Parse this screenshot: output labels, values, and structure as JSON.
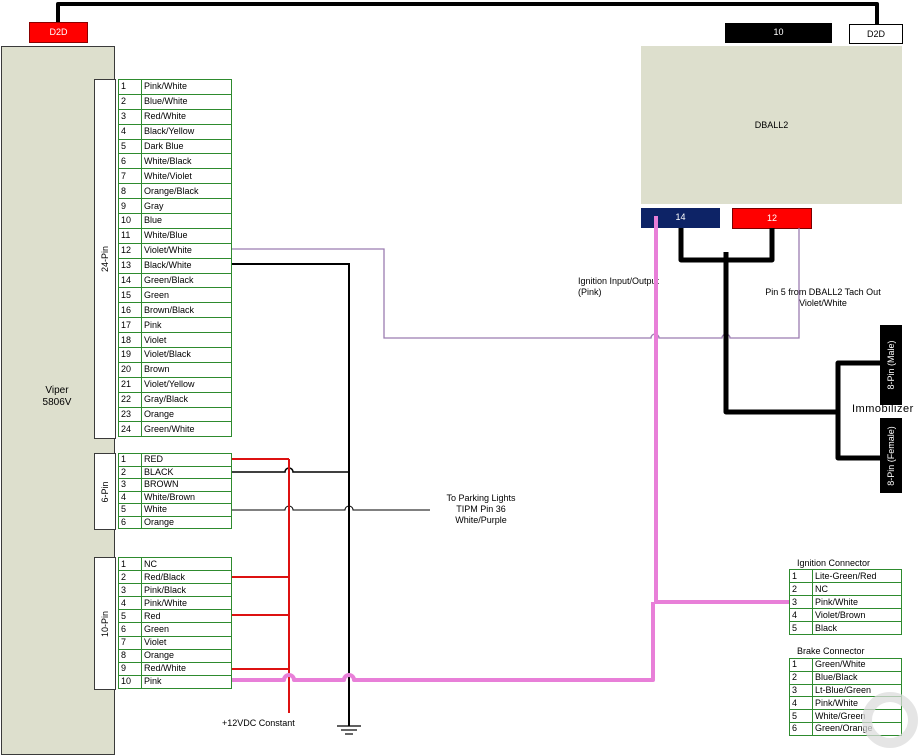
{
  "viper": {
    "name": "Viper",
    "model": "5806V",
    "d2d_label": "D2D",
    "connectors": {
      "pin24": {
        "label": "24-Pin",
        "pins": [
          {
            "num": "1",
            "color": "Pink/White"
          },
          {
            "num": "2",
            "color": "Blue/White"
          },
          {
            "num": "3",
            "color": "Red/White"
          },
          {
            "num": "4",
            "color": "Black/Yellow"
          },
          {
            "num": "5",
            "color": "Dark Blue"
          },
          {
            "num": "6",
            "color": "White/Black"
          },
          {
            "num": "7",
            "color": "White/Violet"
          },
          {
            "num": "8",
            "color": "Orange/Black"
          },
          {
            "num": "9",
            "color": "Gray"
          },
          {
            "num": "10",
            "color": "Blue"
          },
          {
            "num": "11",
            "color": "White/Blue"
          },
          {
            "num": "12",
            "color": "Violet/White"
          },
          {
            "num": "13",
            "color": "Black/White"
          },
          {
            "num": "14",
            "color": "Green/Black"
          },
          {
            "num": "15",
            "color": "Green"
          },
          {
            "num": "16",
            "color": "Brown/Black"
          },
          {
            "num": "17",
            "color": "Pink"
          },
          {
            "num": "18",
            "color": "Violet"
          },
          {
            "num": "19",
            "color": "Violet/Black"
          },
          {
            "num": "20",
            "color": "Brown"
          },
          {
            "num": "21",
            "color": "Violet/Yellow"
          },
          {
            "num": "22",
            "color": "Gray/Black"
          },
          {
            "num": "23",
            "color": "Orange"
          },
          {
            "num": "24",
            "color": "Green/White"
          }
        ]
      },
      "pin6": {
        "label": "6-Pin",
        "pins": [
          {
            "num": "1",
            "color": "RED"
          },
          {
            "num": "2",
            "color": "BLACK"
          },
          {
            "num": "3",
            "color": "BROWN"
          },
          {
            "num": "4",
            "color": "White/Brown"
          },
          {
            "num": "5",
            "color": "White"
          },
          {
            "num": "6",
            "color": "Orange"
          }
        ]
      },
      "pin10": {
        "label": "10-Pin",
        "pins": [
          {
            "num": "1",
            "color": "NC"
          },
          {
            "num": "2",
            "color": "Red/Black"
          },
          {
            "num": "3",
            "color": "Pink/Black"
          },
          {
            "num": "4",
            "color": "Pink/White"
          },
          {
            "num": "5",
            "color": "Red"
          },
          {
            "num": "6",
            "color": "Green"
          },
          {
            "num": "7",
            "color": "Violet"
          },
          {
            "num": "8",
            "color": "Orange"
          },
          {
            "num": "9",
            "color": "Red/White"
          },
          {
            "num": "10",
            "color": "Pink"
          }
        ]
      }
    }
  },
  "dball2": {
    "name": "DBALL2",
    "d2d_label": "D2D",
    "port10_label": "10",
    "port14_label": "14",
    "port12_label": "12"
  },
  "immobilizer": {
    "label": "Immobilizer",
    "male_label": "8-Pin (Male)",
    "female_label": "8-Pin (Female)"
  },
  "notes": {
    "ignition_io_line1": "Ignition Input/Output",
    "ignition_io_line2": "(Pink)",
    "tach_line1": "Pin 5 from DBALL2 Tach Out",
    "tach_line2": "Violet/White",
    "parking_line1": "To Parking Lights",
    "parking_line2": "TIPM Pin 36",
    "parking_line3": "White/Purple",
    "constant_12v": "+12VDC Constant"
  },
  "ignition_connector": {
    "title": "Ignition Connector",
    "pins": [
      {
        "num": "1",
        "color": "Lite-Green/Red"
      },
      {
        "num": "2",
        "color": "NC"
      },
      {
        "num": "3",
        "color": "Pink/White"
      },
      {
        "num": "4",
        "color": "Violet/Brown"
      },
      {
        "num": "5",
        "color": "Black"
      }
    ]
  },
  "brake_connector": {
    "title": "Brake Connector",
    "pins": [
      {
        "num": "1",
        "color": "Green/White"
      },
      {
        "num": "2",
        "color": "Blue/Black"
      },
      {
        "num": "3",
        "color": "Lt-Blue/Green"
      },
      {
        "num": "4",
        "color": "Pink/White"
      },
      {
        "num": "5",
        "color": "White/Green"
      },
      {
        "num": "6",
        "color": "Green/Orange"
      }
    ]
  },
  "colors": {
    "module_fill": "#dddfcd",
    "table_border": "#2e8b2e",
    "d2d_red": "#ff0000",
    "port14_navy": "#0d2366",
    "port12_red": "#ff0000",
    "wire_pink": "#e87fd8",
    "wire_red": "#dd1111",
    "wire_violet": "#9b7cb0",
    "wire_black": "#000000"
  }
}
